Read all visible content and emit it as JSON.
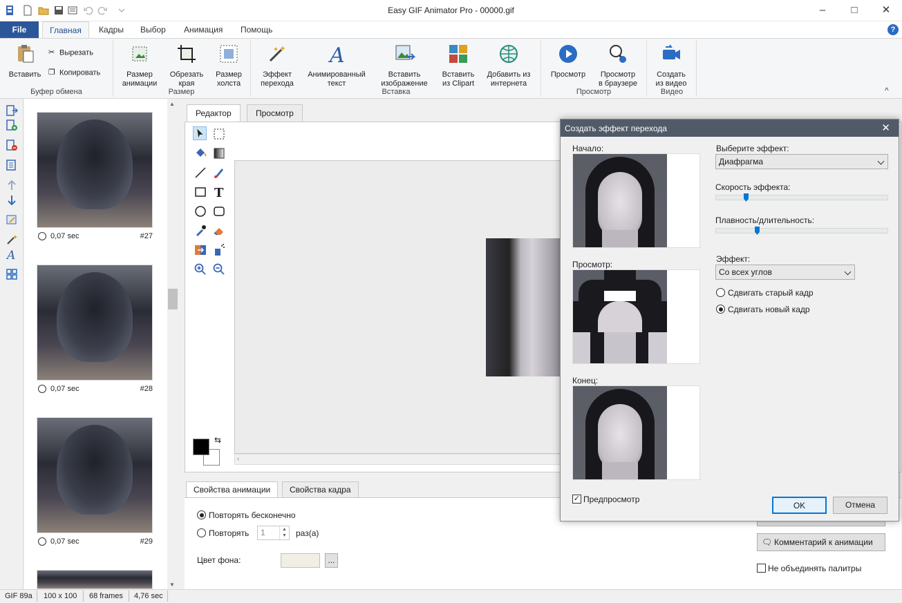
{
  "window": {
    "title": "Easy GIF Animator Pro - 00000.gif"
  },
  "ribbon_tabs": {
    "file": "File",
    "home": "Главная",
    "frames": "Кадры",
    "select": "Выбор",
    "animation": "Анимация",
    "help": "Помощь"
  },
  "clipboard": {
    "paste": "Вставить",
    "cut": "Вырезать",
    "copy": "Копировать",
    "group": "Буфер обмена"
  },
  "size": {
    "resize_l1": "Размер",
    "resize_l2": "анимации",
    "crop_l1": "Обрезать",
    "crop_l2": "края",
    "canvas_l1": "Размер",
    "canvas_l2": "холста",
    "group": "Размер"
  },
  "insert": {
    "transition_l1": "Эффект",
    "transition_l2": "перехода",
    "text_l1": "Анимированный",
    "text_l2": "текст",
    "image_l1": "Вставить",
    "image_l2": "изображение",
    "clipart_l1": "Вставить",
    "clipart_l2": "из Clipart",
    "web_l1": "Добавить из",
    "web_l2": "интернета",
    "group": "Вставка"
  },
  "preview": {
    "preview": "Просмотр",
    "browser_l1": "Просмотр",
    "browser_l2": "в браузере",
    "group": "Просмотр"
  },
  "video": {
    "create_l1": "Создать",
    "create_l2": "из видео",
    "group": "Видео"
  },
  "frames": [
    {
      "time": "0,07 sec",
      "num": "#27"
    },
    {
      "time": "0,07 sec",
      "num": "#28"
    },
    {
      "time": "0,07 sec",
      "num": "#29"
    }
  ],
  "editor_tabs": {
    "editor": "Редактор",
    "preview": "Просмотр"
  },
  "props_tabs": {
    "anim": "Свойства анимации",
    "frame": "Свойства кадра"
  },
  "props": {
    "loop_forever": "Повторять бесконечно",
    "loop_n": "Повторять",
    "loop_count": "1",
    "times": "раз(а)",
    "bg_color_label": "Цвет фона:",
    "browse": "...",
    "comment_btn": "Комментарий к анимации",
    "no_merge": "Не объединять палитры",
    "bg_color": "#f1efe3"
  },
  "status": {
    "format": "GIF 89a",
    "size": "100 x 100",
    "frames": "68 frames",
    "duration": "4,76 sec"
  },
  "dialog": {
    "title": "Создать эффект перехода",
    "start": "Начало:",
    "preview": "Просмотр:",
    "end": "Конец:",
    "choose_effect": "Выберите эффект:",
    "effect_value": "Диафрагма",
    "speed": "Скорость эффекта:",
    "speed_value": 0.18,
    "smooth": "Плавность/длительность:",
    "smooth_value": 0.24,
    "effect2": "Эффект:",
    "effect2_value": "Со всех углов",
    "shift_old": "Сдвигать старый кадр",
    "shift_new": "Сдвигать новый кадр",
    "preview_chk": "Предпросмотр",
    "ok": "OK",
    "cancel": "Отмена"
  },
  "colors": {
    "accent": "#2b579a",
    "dialog_title": "#515a68",
    "slider": "#0078d7"
  }
}
